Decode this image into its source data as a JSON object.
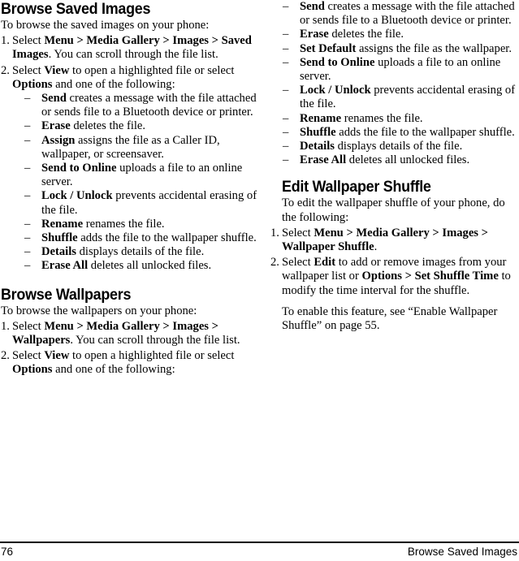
{
  "page": {
    "folio": "76",
    "running_head": "Browse Saved Images"
  },
  "left_column": {
    "sections": [
      {
        "heading": "Browse Saved Images",
        "lead": "To browse the saved images on your phone:",
        "steps": [
          {
            "number": "1.",
            "text_parts": [
              {
                "text": "Select ",
                "bold": false
              },
              {
                "text": "Menu > Media Gallery > Images > Saved Images",
                "bold": true
              },
              {
                "text": ". You can scroll through the file list.",
                "bold": false
              }
            ]
          },
          {
            "number": "2.",
            "text_parts": [
              {
                "text": "Select ",
                "bold": false
              },
              {
                "text": "View",
                "bold": true
              },
              {
                "text": " to open a highlighted file or select ",
                "bold": false
              },
              {
                "text": "Options",
                "bold": true
              },
              {
                "text": " and one of the following:",
                "bold": false
              }
            ],
            "sub_items": [
              {
                "dash": "–",
                "term": "Send",
                "desc": " creates a message with the file attached or sends file to a Bluetooth device or printer."
              },
              {
                "dash": "–",
                "term": "Erase",
                "desc": " deletes the file."
              },
              {
                "dash": "–",
                "term": "Assign",
                "desc": " assigns the file as a Caller ID, wallpaper, or screensaver."
              },
              {
                "dash": "–",
                "term": "Send to Online",
                "desc": " uploads a file to an online server."
              },
              {
                "dash": "–",
                "term": "Lock / Unlock",
                "desc": " prevents accidental erasing of the file."
              },
              {
                "dash": "–",
                "term": "Rename",
                "desc": " renames the file."
              },
              {
                "dash": "–",
                "term": "Shuffle",
                "desc": " adds the file to the wallpaper shuffle."
              },
              {
                "dash": "–",
                "term": "Details",
                "desc": " displays details of the file."
              },
              {
                "dash": "–",
                "term": "Erase All",
                "desc": " deletes all unlocked files."
              }
            ]
          }
        ]
      },
      {
        "heading": "Browse Wallpapers",
        "lead": "To browse the wallpapers on your phone:",
        "steps": [
          {
            "number": "1.",
            "text_parts": [
              {
                "text": "Select ",
                "bold": false
              },
              {
                "text": "Menu > Media Gallery > Images > Wallpapers",
                "bold": true
              },
              {
                "text": ". You can scroll through the file list.",
                "bold": false
              }
            ]
          },
          {
            "number": "2.",
            "text_parts": [
              {
                "text": "Select ",
                "bold": false
              },
              {
                "text": "View",
                "bold": true
              },
              {
                "text": " to open a highlighted file or select ",
                "bold": false
              },
              {
                "text": "Options",
                "bold": true
              },
              {
                "text": " and one of the following:",
                "bold": false
              }
            ],
            "sub_items": []
          }
        ]
      }
    ]
  },
  "right_column": {
    "continued_sub_items": [
      {
        "dash": "–",
        "term": "Send",
        "desc": " creates a message with the file attached or sends file to a Bluetooth device or printer."
      },
      {
        "dash": "–",
        "term": "Erase",
        "desc": " deletes the file."
      },
      {
        "dash": "–",
        "term": "Set Default",
        "desc": " assigns the file as the wallpaper."
      },
      {
        "dash": "–",
        "term": "Send to Online",
        "desc": " uploads a file to an online server."
      },
      {
        "dash": "–",
        "term": "Lock / Unlock",
        "desc": " prevents accidental erasing of the file."
      },
      {
        "dash": "–",
        "term": "Rename",
        "desc": " renames the file."
      },
      {
        "dash": "–",
        "term": "Shuffle",
        "desc": " adds the file to the wallpaper shuffle."
      },
      {
        "dash": "–",
        "term": "Details",
        "desc": " displays details of the file."
      },
      {
        "dash": "–",
        "term": "Erase All",
        "desc": " deletes all unlocked files."
      }
    ],
    "sections": [
      {
        "heading": "Edit Wallpaper Shuffle",
        "lead": "To edit the wallpaper shuffle of your phone, do the following:",
        "steps": [
          {
            "number": "1.",
            "text_parts": [
              {
                "text": "Select ",
                "bold": false
              },
              {
                "text": "Menu > Media Gallery > Images > Wallpaper Shuffle",
                "bold": true
              },
              {
                "text": ".",
                "bold": false
              }
            ]
          },
          {
            "number": "2.",
            "text_parts": [
              {
                "text": "Select ",
                "bold": false
              },
              {
                "text": "Edit",
                "bold": true
              },
              {
                "text": " to add or remove images from your wallpaper list or ",
                "bold": false
              },
              {
                "text": "Options > Set Shuffle Time",
                "bold": true
              },
              {
                "text": " to modify the time interval for the shuffle.",
                "bold": false
              }
            ]
          }
        ],
        "note": "To enable this feature, see “Enable Wallpaper Shuffle” on page 55."
      }
    ]
  }
}
